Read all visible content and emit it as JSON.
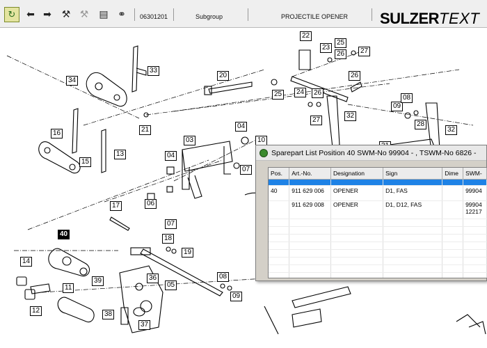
{
  "toolbar": {
    "buttons": [
      {
        "name": "refresh-icon",
        "glyph": "↻"
      },
      {
        "name": "back-arrow-icon",
        "glyph": "⬅"
      },
      {
        "name": "forward-arrow-icon",
        "glyph": "➡"
      },
      {
        "name": "wrench-icon",
        "glyph": "🔧"
      },
      {
        "name": "tool-disabled-icon",
        "glyph": "🔧"
      },
      {
        "name": "document-icon",
        "glyph": "▤"
      },
      {
        "name": "binoculars-icon",
        "glyph": "⚭"
      }
    ],
    "part_number": "06301201",
    "group_label": "Subgroup",
    "group_name": "PROJECTILE OPENER",
    "brand_main": "SULZER",
    "brand_suffix": "TEXT"
  },
  "callouts": [
    "33",
    "34",
    "20",
    "22",
    "23",
    "25",
    "26",
    "27",
    "21",
    "16",
    "15",
    "13",
    "04",
    "03",
    "04",
    "10",
    "07",
    "05",
    "17",
    "06",
    "07",
    "40",
    "18",
    "19",
    "14",
    "39",
    "11",
    "12",
    "38",
    "36",
    "37",
    "05",
    "08",
    "09",
    "25",
    "24",
    "26",
    "27",
    "26",
    "32",
    "09",
    "08",
    "28",
    "32",
    "31",
    "19"
  ],
  "dialog": {
    "title": "Sparepart List Position 40 SWM-No 99904 - , TSWM-No 6826 -",
    "columns": [
      "Pos.",
      "Art.-No.",
      "Designation",
      "Sign",
      "Dime",
      "SWM-"
    ],
    "rows": [
      {
        "pos": "",
        "art": "",
        "designation": "",
        "sign": "",
        "dime": "",
        "swm": "",
        "selected": true
      },
      {
        "pos": "40",
        "art": "911 629 006",
        "designation": "OPENER",
        "sign": "D1, FAS",
        "dime": "",
        "swm": "99904"
      },
      {
        "pos": "",
        "art": "911 629 008",
        "designation": "OPENER",
        "sign": "D1, D12, FAS",
        "dime": "",
        "swm": "99904 12217"
      }
    ]
  },
  "colors": {
    "selection": "#1e82e6",
    "toolbar": "#efefef",
    "dialog": "#d4d0c8"
  }
}
